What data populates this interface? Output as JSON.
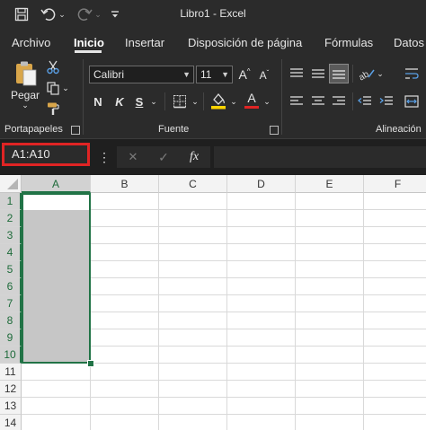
{
  "title": "Libro1 - Excel",
  "quick_access": {
    "save_icon": "save-icon",
    "undo_icon": "undo-icon",
    "redo_icon": "redo-icon",
    "customize_icon": "customize-icon"
  },
  "tabs": [
    "Archivo",
    "Inicio",
    "Insertar",
    "Disposición de página",
    "Fórmulas",
    "Datos"
  ],
  "active_tab": "Inicio",
  "ribbon": {
    "paste_label": "Pegar",
    "font_name": "Calibri",
    "font_size": "11",
    "bold": "N",
    "italic": "K",
    "underline": "S",
    "grow_font": "A",
    "shrink_font": "A",
    "font_color_letter": "A",
    "groups": [
      "Portapapeles",
      "Fuente",
      "Alineación"
    ]
  },
  "formula_bar": {
    "name_box": "A1:A10",
    "fx": "fx",
    "cancel": "✕",
    "enter": "✓",
    "more": "⋮"
  },
  "sheet": {
    "columns": [
      "A",
      "B",
      "C",
      "D",
      "E",
      "F"
    ],
    "rows": [
      "1",
      "2",
      "3",
      "4",
      "5",
      "6",
      "7",
      "8",
      "9",
      "10",
      "11",
      "12",
      "13",
      "14"
    ],
    "selected_range": "A1:A10"
  },
  "colors": {
    "accent": "#217346",
    "highlight": "#e02424",
    "fill_yellow": "#ffd400",
    "font_red": "#e02424"
  }
}
